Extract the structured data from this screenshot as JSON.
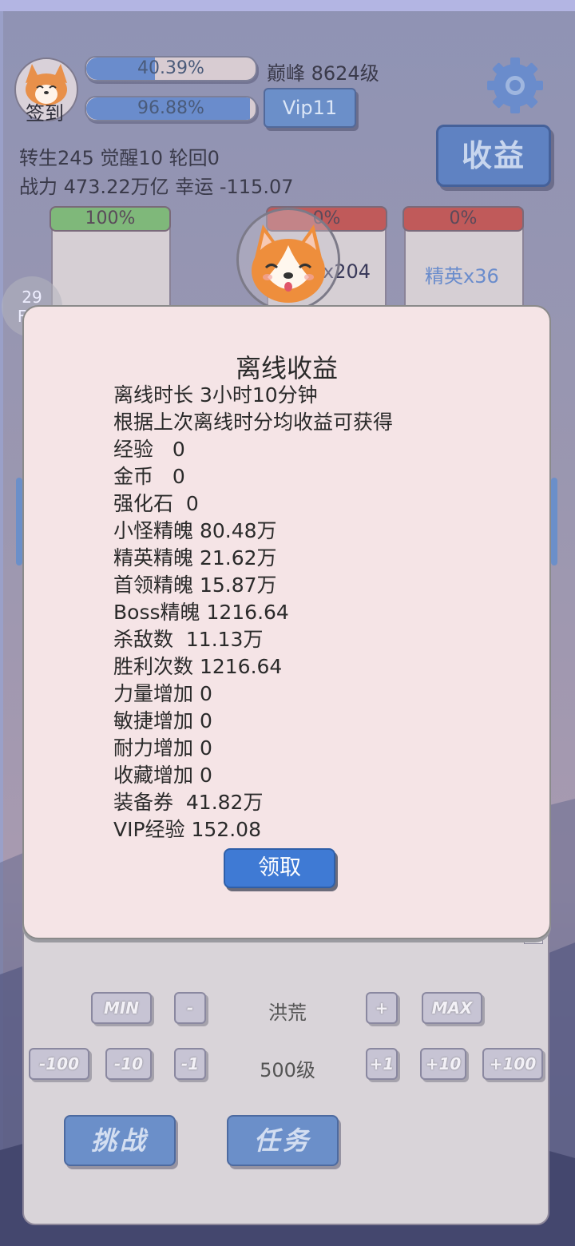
{
  "hud": {
    "signin_label": "签到",
    "progress_1": {
      "text": "40.39%",
      "fraction": 0.4039
    },
    "progress_2": {
      "text": "96.88%",
      "fraction": 0.9688
    },
    "peak_level": "巅峰 8624级",
    "vip_label": "Vip11",
    "stats_line1": "转生245 觉醒10 轮回0",
    "stats_line2": "战力 473.22万亿  幸运 -115.07",
    "income_label": "收益"
  },
  "cards": [
    {
      "bar": "100%",
      "label": "",
      "color": "#7fb87a"
    },
    {
      "bar": "0%",
      "label": "x204",
      "color": "#c05a5a"
    },
    {
      "bar": "0%",
      "label": "精英x36",
      "color": "#c05a5a"
    }
  ],
  "fps": {
    "value": "29",
    "unit": "FPS"
  },
  "modal": {
    "title": "离线收益",
    "lines": [
      "离线时长 3小时10分钟",
      "根据上次离线时分均收益可获得",
      "经验   0",
      "金币   0",
      "强化石  0",
      "小怪精魄 80.48万",
      "精英精魄 21.62万",
      "首领精魄 15.87万",
      "Boss精魄 1216.64",
      "杀敌数  11.13万",
      "胜利次数 1216.64",
      "力量增加 0",
      "敏捷增加 0",
      "耐力增加 0",
      "收藏增加 0",
      "装备券  41.82万",
      "VIP经验 152.08"
    ],
    "claim_label": "领取"
  },
  "panel": {
    "min_label": "MIN",
    "minus_label": "-",
    "realm": "洪荒",
    "plus_label": "+",
    "max_label": "MAX",
    "minus100": "-100",
    "minus10": "-10",
    "minus1": "-1",
    "level": "500级",
    "plus1": "+1",
    "plus10": "+10",
    "plus100": "+100",
    "challenge_label": "挑战",
    "task_label": "任务"
  },
  "colors": {
    "accent_blue": "#6b8fc9",
    "modal_bg": "#f5e4e6",
    "claim_blue": "#3f7ad4"
  }
}
